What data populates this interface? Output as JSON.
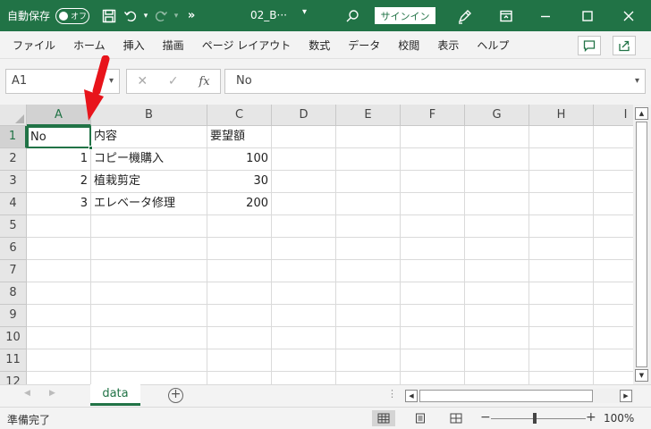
{
  "titlebar": {
    "autosave_label": "自動保存",
    "autosave_state": "オフ",
    "filename": "02_B···",
    "signin_label": "サインイン",
    "accent_color": "#217346"
  },
  "ribbon": {
    "tabs": [
      "ファイル",
      "ホーム",
      "挿入",
      "描画",
      "ページ レイアウト",
      "数式",
      "データ",
      "校閲",
      "表示",
      "ヘルプ"
    ]
  },
  "formula_bar": {
    "name_box": "A1",
    "formula": "No",
    "fx_label": "fx"
  },
  "grid": {
    "columns": [
      "A",
      "B",
      "C",
      "D",
      "E",
      "F",
      "G",
      "H",
      "I"
    ],
    "rows": [
      "1",
      "2",
      "3",
      "4",
      "5",
      "6",
      "7",
      "8",
      "9",
      "10",
      "11",
      "12"
    ],
    "cells": {
      "A1": "No",
      "B1": "内容",
      "C1": "要望額",
      "A2": "1",
      "B2": "コピー機購入",
      "C2": "100",
      "A3": "2",
      "B3": "植栽剪定",
      "C3": "30",
      "A4": "3",
      "B4": "エレベータ修理",
      "C4": "200"
    },
    "active_cell": "A1"
  },
  "sheets": {
    "active_tab": "data"
  },
  "status": {
    "text": "準備完了",
    "zoom": "100%"
  }
}
